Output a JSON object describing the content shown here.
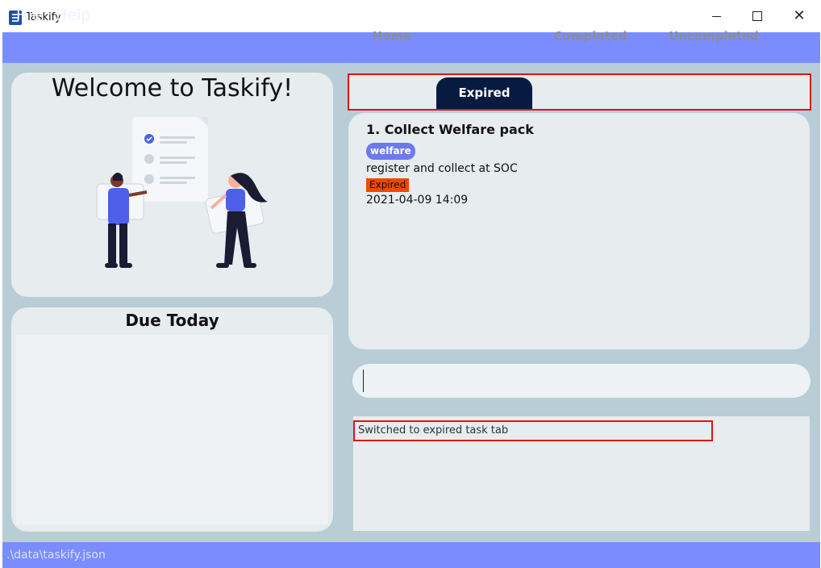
{
  "window": {
    "title": "Taskify",
    "controls": [
      "minimize-icon",
      "maximize-icon",
      "close-icon"
    ]
  },
  "menu": {
    "items": [
      {
        "label": "File"
      },
      {
        "label": "Help"
      }
    ]
  },
  "welcome": {
    "title": "Welcome to Taskify!"
  },
  "due_today": {
    "title": "Due Today",
    "items": []
  },
  "tabs": [
    {
      "label": "Home",
      "selected": false
    },
    {
      "label": "Expired",
      "selected": true
    },
    {
      "label": "Completed",
      "selected": false
    },
    {
      "label": "Uncompleted",
      "selected": false
    }
  ],
  "tasks": [
    {
      "title": "1. Collect Welfare pack",
      "tags": [
        "welfare"
      ],
      "description": "register and collect at SOC",
      "status": "Expired",
      "date": "2021-04-09 14:09"
    }
  ],
  "command": {
    "value": ""
  },
  "result": {
    "message": "Switched to expired task tab"
  },
  "status_bar": {
    "path": ".\\data\\taskify.json"
  },
  "colors": {
    "menubar": "#7b8cff",
    "selected_tab": "#071b40",
    "tag": "#6d79f0",
    "expired_status": "#ef4800",
    "highlight_border": "#e01414"
  }
}
